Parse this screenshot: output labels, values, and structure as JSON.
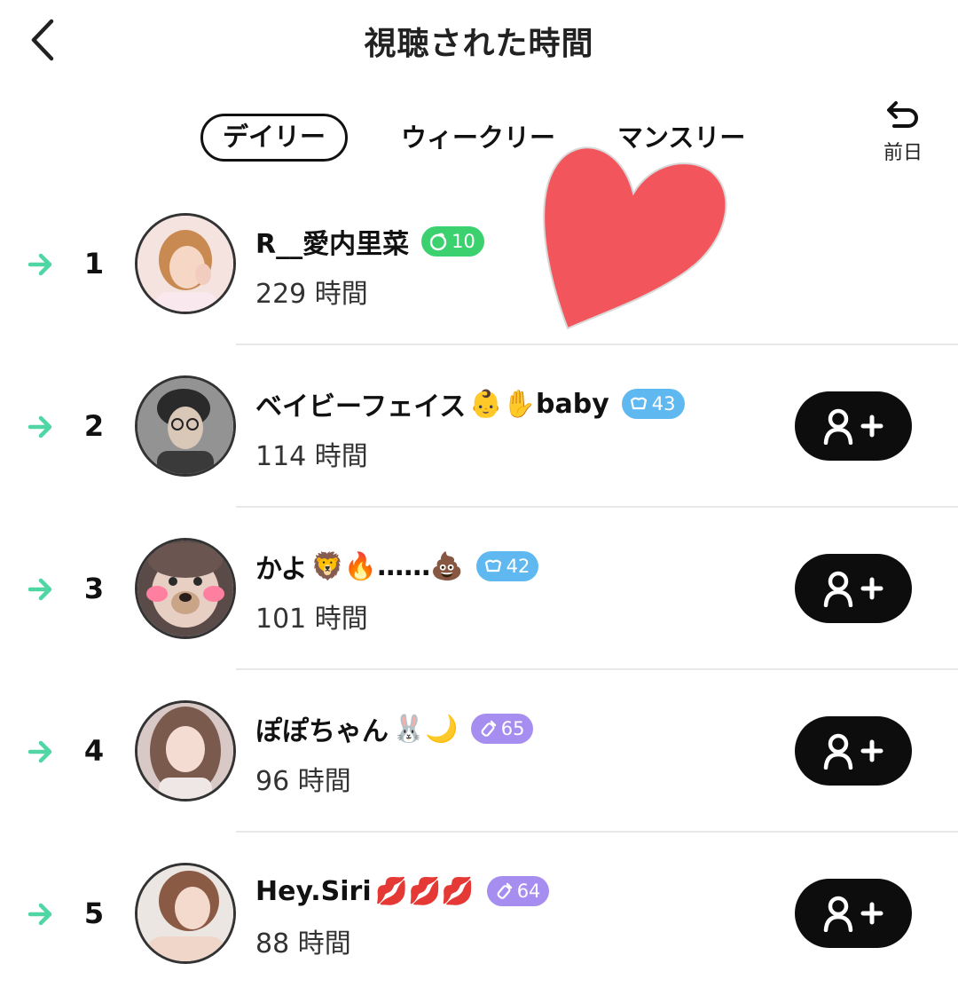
{
  "header": {
    "title": "視聴された時間"
  },
  "tabs": [
    {
      "label": "デイリー",
      "active": true
    },
    {
      "label": "ウィークリー",
      "active": false
    },
    {
      "label": "マンスリー",
      "active": false
    }
  ],
  "prev_day": {
    "label": "前日"
  },
  "colors": {
    "trend": "#4fd6a4",
    "green_badge": "#3bd16f",
    "blue_badge": "#5fb9f0",
    "purple_badge": "#a68df0",
    "heart": "#f2555c"
  },
  "ranking": [
    {
      "rank": "1",
      "name": "R__愛内里菜",
      "emojis": "",
      "badge": {
        "value": "10",
        "color": "#3bd16f",
        "icon": "leaf-badge-icon"
      },
      "hours": "229 時間",
      "trend": "arrow-right-icon",
      "follow": false
    },
    {
      "rank": "2",
      "name": "ベイビーフェイス",
      "emojis": "👶✋",
      "name_suffix": "baby",
      "badge": {
        "value": "43",
        "color": "#5fb9f0",
        "icon": "crown-badge-icon"
      },
      "hours": "114 時間",
      "trend": "arrow-right-icon",
      "follow": true
    },
    {
      "rank": "3",
      "name": "かよ",
      "emojis": "🦁🔥",
      "name_suffix": "……💩",
      "badge": {
        "value": "42",
        "color": "#5fb9f0",
        "icon": "crown-badge-icon"
      },
      "hours": "101 時間",
      "trend": "arrow-right-icon",
      "follow": true
    },
    {
      "rank": "4",
      "name": "ぽぽちゃん",
      "emojis": "🐰🌙",
      "badge": {
        "value": "65",
        "color": "#a68df0",
        "icon": "bottle-badge-icon"
      },
      "hours": "96 時間",
      "trend": "arrow-right-icon",
      "follow": true
    },
    {
      "rank": "5",
      "name": "Hey.Siri",
      "emojis": "💋💋💋",
      "badge": {
        "value": "64",
        "color": "#a68df0",
        "icon": "bottle-badge-icon"
      },
      "hours": "88 時間",
      "trend": "arrow-right-icon",
      "follow": true
    }
  ]
}
